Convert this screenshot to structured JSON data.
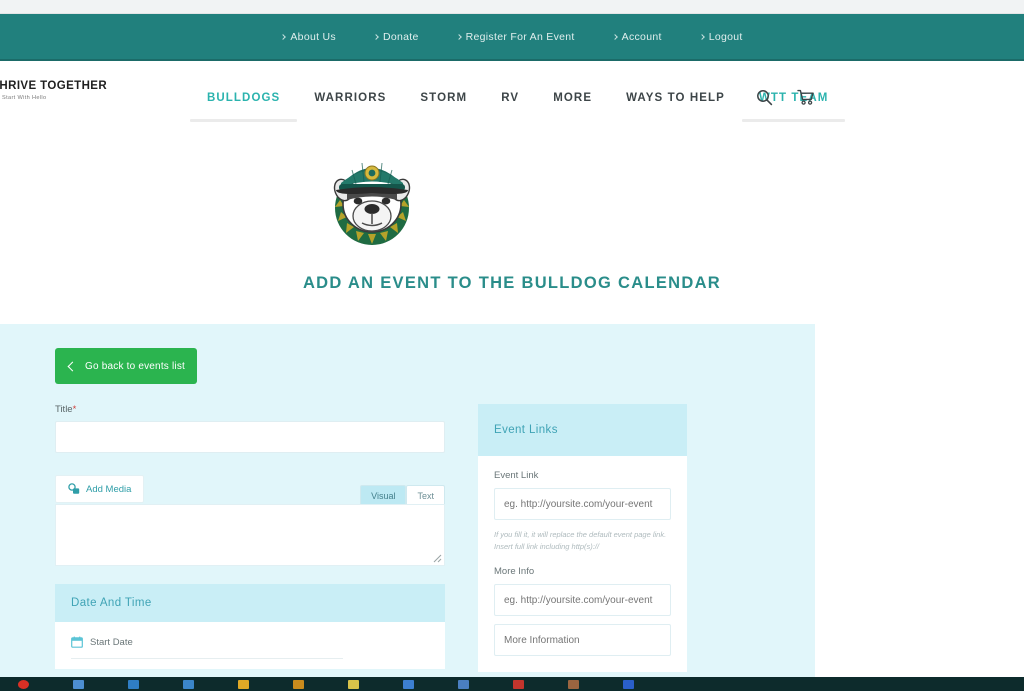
{
  "utility_bar": {
    "links": [
      {
        "label": "About Us"
      },
      {
        "label": "Donate"
      },
      {
        "label": "Register For An Event"
      },
      {
        "label": "Account"
      },
      {
        "label": "Logout"
      }
    ]
  },
  "brand": {
    "name": "THRIVE TOGETHER",
    "tagline": "Start With Hello"
  },
  "main_nav": {
    "items": [
      {
        "label": "BULLDOGS",
        "active": true,
        "underline": true
      },
      {
        "label": "WARRIORS",
        "active": false,
        "underline": false
      },
      {
        "label": "STORM",
        "active": false,
        "underline": false
      },
      {
        "label": "RV",
        "active": false,
        "underline": false
      },
      {
        "label": "MORE",
        "active": false,
        "underline": false
      },
      {
        "label": "WAYS TO HELP",
        "active": false,
        "underline": false
      },
      {
        "label": "WTT TEAM",
        "active": true,
        "underline": true
      }
    ],
    "search_icon": "search-icon",
    "cart_icon": "shopping-cart-icon"
  },
  "hero": {
    "mascot_alt": "bulldog-mascot-logo",
    "page_title": "ADD AN EVENT TO THE BULLDOG CALENDAR"
  },
  "form": {
    "back_button": "Go back to events list",
    "title_field": {
      "label": "Title",
      "required_mark": "*",
      "value": "",
      "placeholder": ""
    },
    "editor": {
      "add_media_label": "Add Media",
      "tabs": [
        {
          "label": "Visual",
          "active": true
        },
        {
          "label": "Text",
          "active": false
        }
      ],
      "content": ""
    },
    "date_panel": {
      "header": "Date And Time",
      "start_date_label": "Start Date"
    },
    "links_panel": {
      "header": "Event Links",
      "event_link": {
        "label": "Event Link",
        "placeholder": "eg. http://yoursite.com/your-event",
        "value": ""
      },
      "event_link_help": "If you fill it, it will replace the default event page link. Insert full link including http(s)://",
      "more_info": {
        "label": "More Info",
        "placeholder": "eg. http://yoursite.com/your-event",
        "value": ""
      },
      "more_information": {
        "placeholder": "More Information",
        "value": ""
      }
    }
  },
  "colors": {
    "teal_bar": "#21807d",
    "accent_teal": "#2bb3ae",
    "title_teal": "#2a8d8a",
    "panel_header": "#c9eef6",
    "form_background": "#e1f6fa",
    "green_button": "#2bb44f",
    "required_red": "#d0403a"
  },
  "taskbar": {
    "icons": [
      {
        "name": "record-icon",
        "color": "#d93025"
      },
      {
        "name": "window-icon",
        "color": "#4d8fd1"
      },
      {
        "name": "browser-icon",
        "color": "#2f7ec4"
      },
      {
        "name": "explorer-icon",
        "color": "#3b86c9"
      },
      {
        "name": "folder-icon",
        "color": "#e0a926"
      },
      {
        "name": "app-icon",
        "color": "#c98b1d"
      },
      {
        "name": "note-icon",
        "color": "#d8c34a"
      },
      {
        "name": "chrome-icon",
        "color": "#3c7fd0"
      },
      {
        "name": "teams-icon",
        "color": "#4a7fc1"
      },
      {
        "name": "pdf-icon",
        "color": "#c2352d"
      },
      {
        "name": "box-icon",
        "color": "#9b6540"
      },
      {
        "name": "mail-icon",
        "color": "#2a5fc9"
      }
    ]
  }
}
